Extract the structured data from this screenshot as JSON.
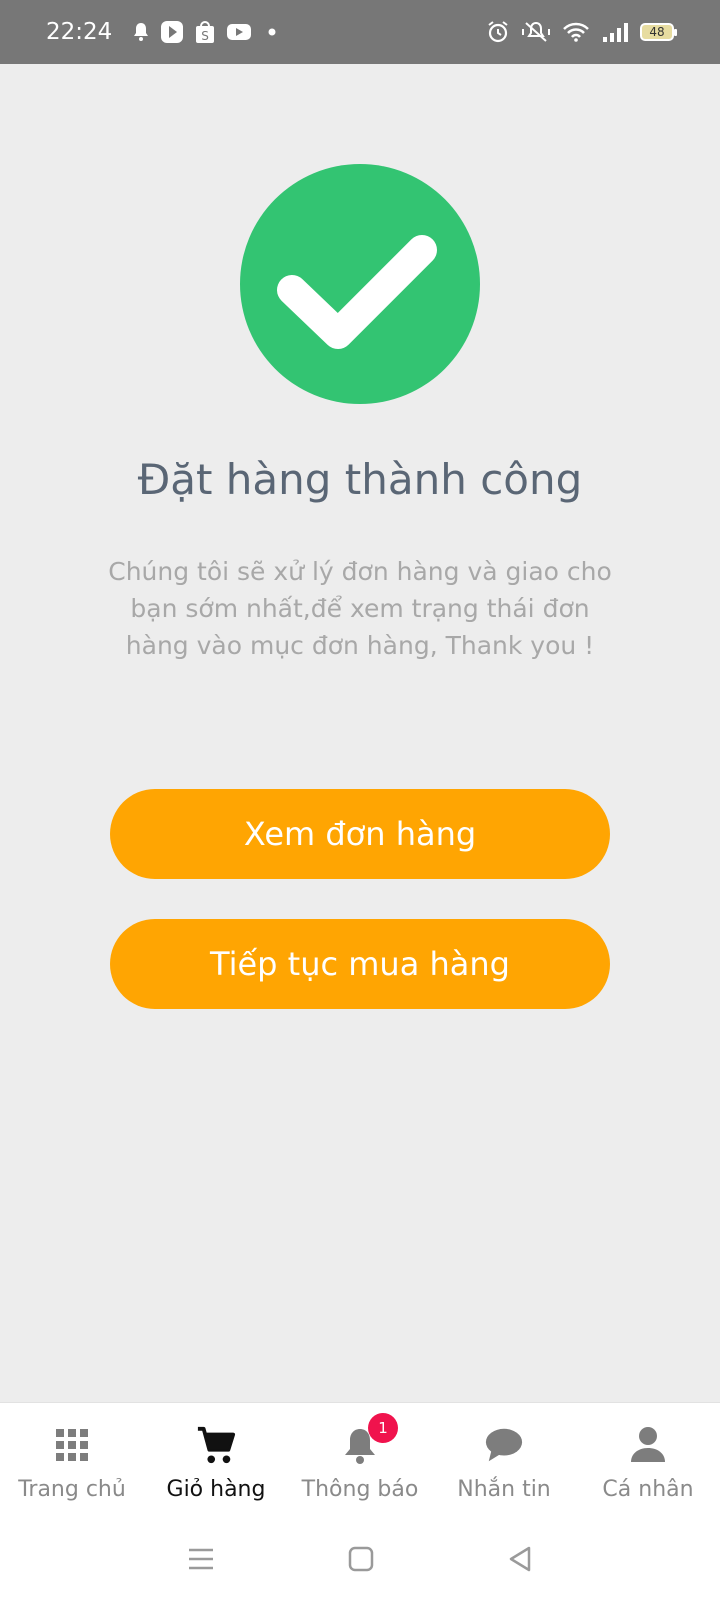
{
  "status_bar": {
    "time": "22:24",
    "battery": "48",
    "icons_left": [
      "bell-icon",
      "play-icon",
      "shopee-icon",
      "youtube-icon",
      "dot-icon"
    ],
    "icons_right": [
      "alarm-icon",
      "mute-icon",
      "wifi-icon",
      "signal-icon",
      "battery-icon"
    ]
  },
  "main": {
    "title": "Đặt hàng thành công",
    "message": "Chúng tôi sẽ xử lý đơn hàng và giao cho bạn sớm nhất,để xem trạng thái đơn hàng vào mục đơn hàng, Thank you !",
    "view_orders_label": "Xem đơn hàng",
    "continue_shopping_label": "Tiếp tục mua hàng"
  },
  "bottom_nav": {
    "items": [
      {
        "label": "Trang chủ",
        "icon": "grid-icon"
      },
      {
        "label": "Giỏ hàng",
        "icon": "cart-icon"
      },
      {
        "label": "Thông báo",
        "icon": "bell-icon",
        "badge": "1"
      },
      {
        "label": "Nhắn tin",
        "icon": "chat-icon"
      },
      {
        "label": "Cá nhân",
        "icon": "person-icon"
      }
    ],
    "active": "Giỏ hàng"
  },
  "colors": {
    "success_green": "#33c472",
    "button_orange": "#ffa502",
    "badge_red": "#f0134d",
    "title_gray": "#5a6675"
  }
}
